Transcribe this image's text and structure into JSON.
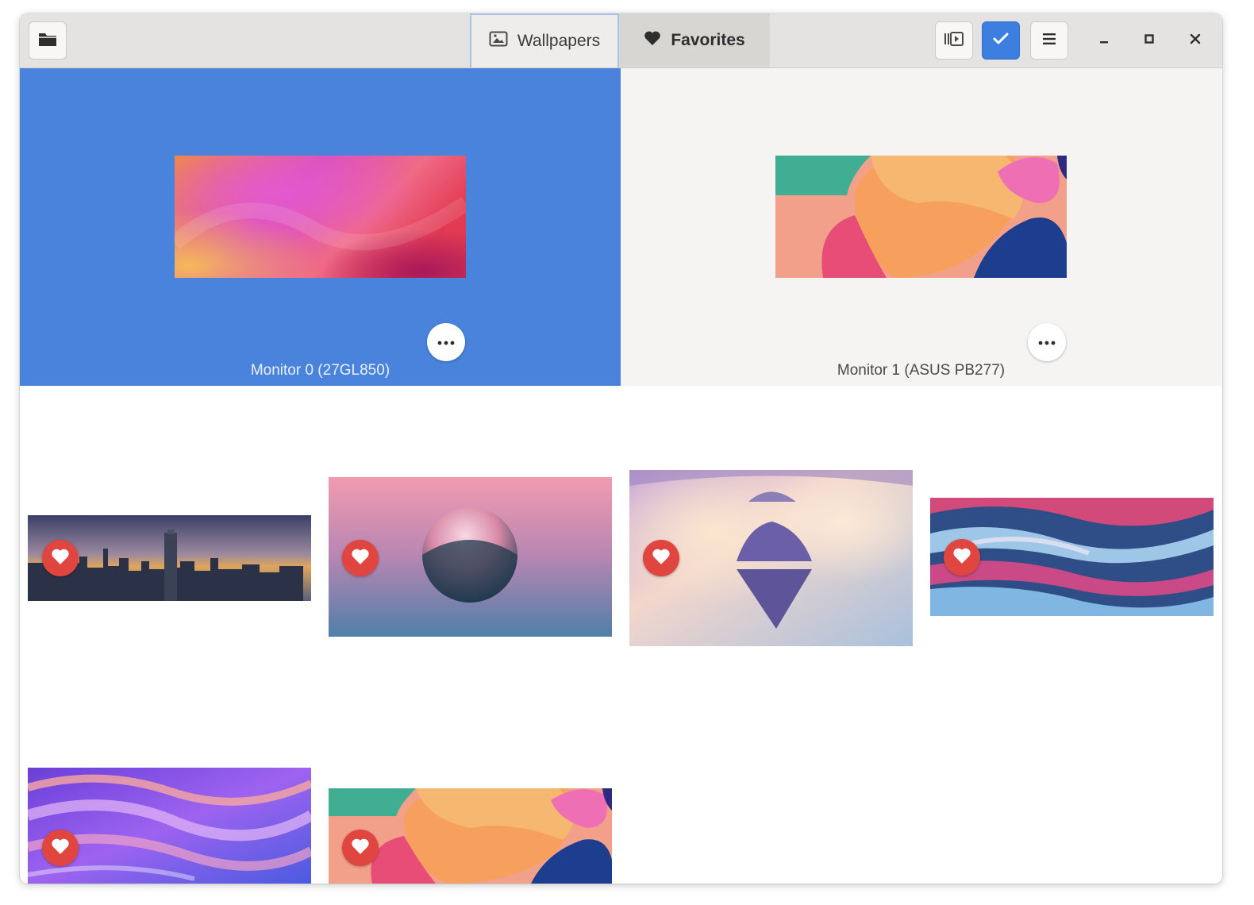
{
  "header": {
    "tabs": [
      {
        "label": "Wallpapers",
        "icon": "image-icon",
        "active": true
      },
      {
        "label": "Favorites",
        "icon": "heart-icon",
        "active": false
      }
    ],
    "left_button_icon": "folder-icon",
    "right_buttons": [
      "preview-panel-icon",
      "checkmark-icon",
      "hamburger-menu-icon"
    ],
    "window_controls": [
      "minimize-icon",
      "maximize-icon",
      "close-icon"
    ]
  },
  "monitors": [
    {
      "label": "Monitor 0 (27GL850)",
      "selected": true,
      "more_icon": "more-dots-icon"
    },
    {
      "label": "Monitor 1 (ASUS PB277)",
      "selected": false,
      "more_icon": "more-dots-icon"
    }
  ],
  "gallery": {
    "favorite_icon": "heart-icon",
    "wallpapers": [
      {
        "subject": "city-skyline-sunset",
        "favorite": true
      },
      {
        "subject": "pink-sphere",
        "favorite": true
      },
      {
        "subject": "floating-island-clouds",
        "favorite": true
      },
      {
        "subject": "abstract-paint-clouds",
        "favorite": true
      },
      {
        "subject": "purple-waves",
        "favorite": true
      },
      {
        "subject": "colorful-shapes",
        "favorite": true
      }
    ]
  },
  "colors": {
    "selection_blue": "#4a83dc",
    "accent_blue": "#3d7fe0",
    "favorite_red": "#e0453f",
    "header_bg": "#e5e3e1"
  }
}
